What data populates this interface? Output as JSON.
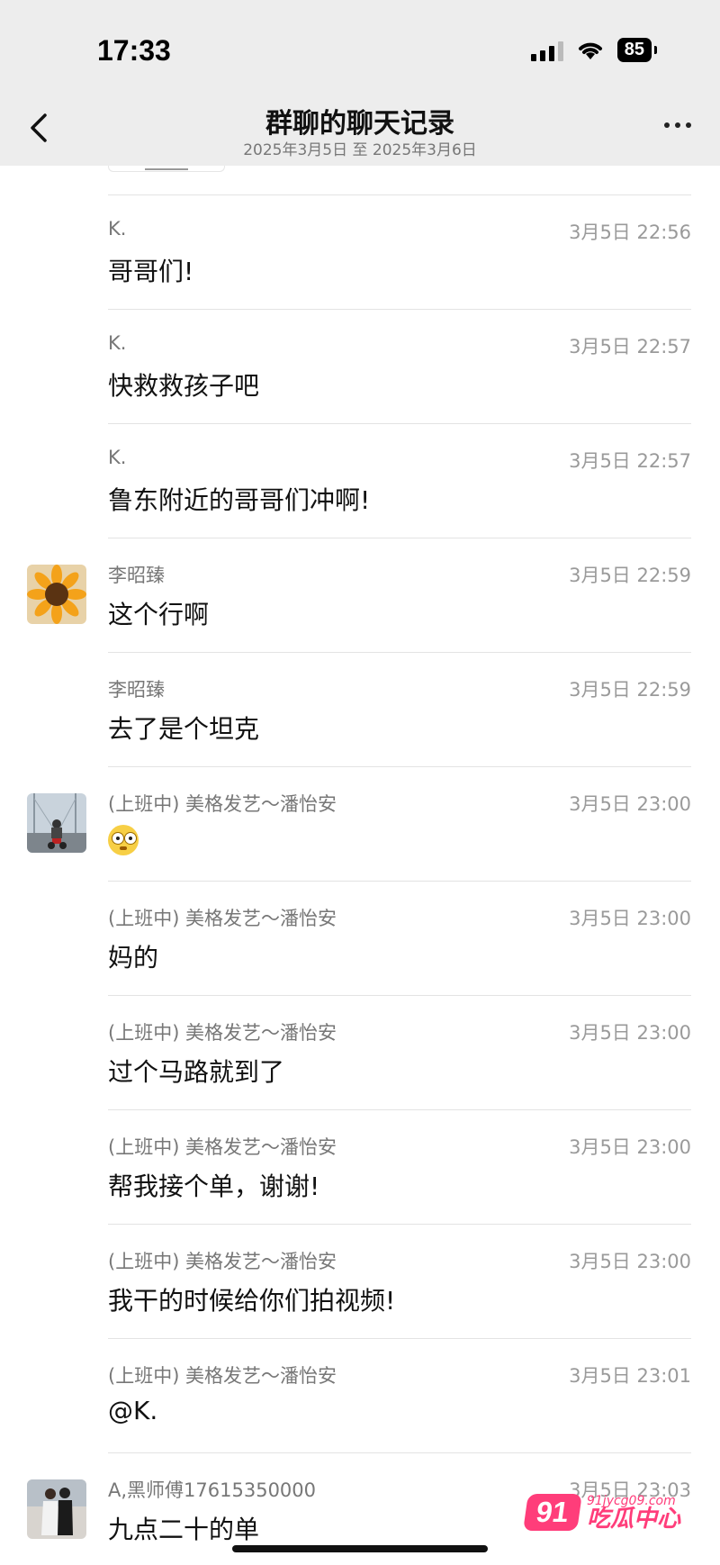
{
  "status": {
    "time": "17:33",
    "battery": "85"
  },
  "nav": {
    "title": "群聊的聊天记录",
    "subtitle": "2025年3月5日 至 2025年3月6日"
  },
  "messages": [
    {
      "sender": "K.",
      "time": "3月5日 22:56",
      "text": "哥哥们!",
      "avatar": ""
    },
    {
      "sender": "K.",
      "time": "3月5日 22:57",
      "text": "快救救孩子吧",
      "avatar": ""
    },
    {
      "sender": "K.",
      "time": "3月5日 22:57",
      "text": "鲁东附近的哥哥们冲啊!",
      "avatar": ""
    },
    {
      "sender": "李昭臻",
      "time": "3月5日 22:59",
      "text": "这个行啊",
      "avatar": "sunflower"
    },
    {
      "sender": "李昭臻",
      "time": "3月5日 22:59",
      "text": "去了是个坦克",
      "avatar": ""
    },
    {
      "sender": "(上班中) 美格发艺～潘怡安",
      "time": "3月5日 23:00",
      "text": "",
      "emoji": "flushed-face",
      "avatar": "bridge-motorbike"
    },
    {
      "sender": "(上班中) 美格发艺～潘怡安",
      "time": "3月5日 23:00",
      "text": "妈的",
      "avatar": ""
    },
    {
      "sender": "(上班中) 美格发艺～潘怡安",
      "time": "3月5日 23:00",
      "text": "过个马路就到了",
      "avatar": ""
    },
    {
      "sender": "(上班中) 美格发艺～潘怡安",
      "time": "3月5日 23:00",
      "text": "帮我接个单，谢谢!",
      "avatar": ""
    },
    {
      "sender": "(上班中) 美格发艺～潘怡安",
      "time": "3月5日 23:00",
      "text": "我干的时候给你们拍视频!",
      "avatar": ""
    },
    {
      "sender": "(上班中) 美格发艺～潘怡安",
      "time": "3月5日 23:01",
      "text": "@K.",
      "avatar": ""
    },
    {
      "sender": "A,黑师傅17615350000",
      "time": "3月5日 23:03",
      "text": "九点二十的单",
      "avatar": "couple"
    }
  ],
  "watermark": {
    "badge": "91",
    "domain": "91jycg09.com",
    "name": "吃瓜中心"
  }
}
